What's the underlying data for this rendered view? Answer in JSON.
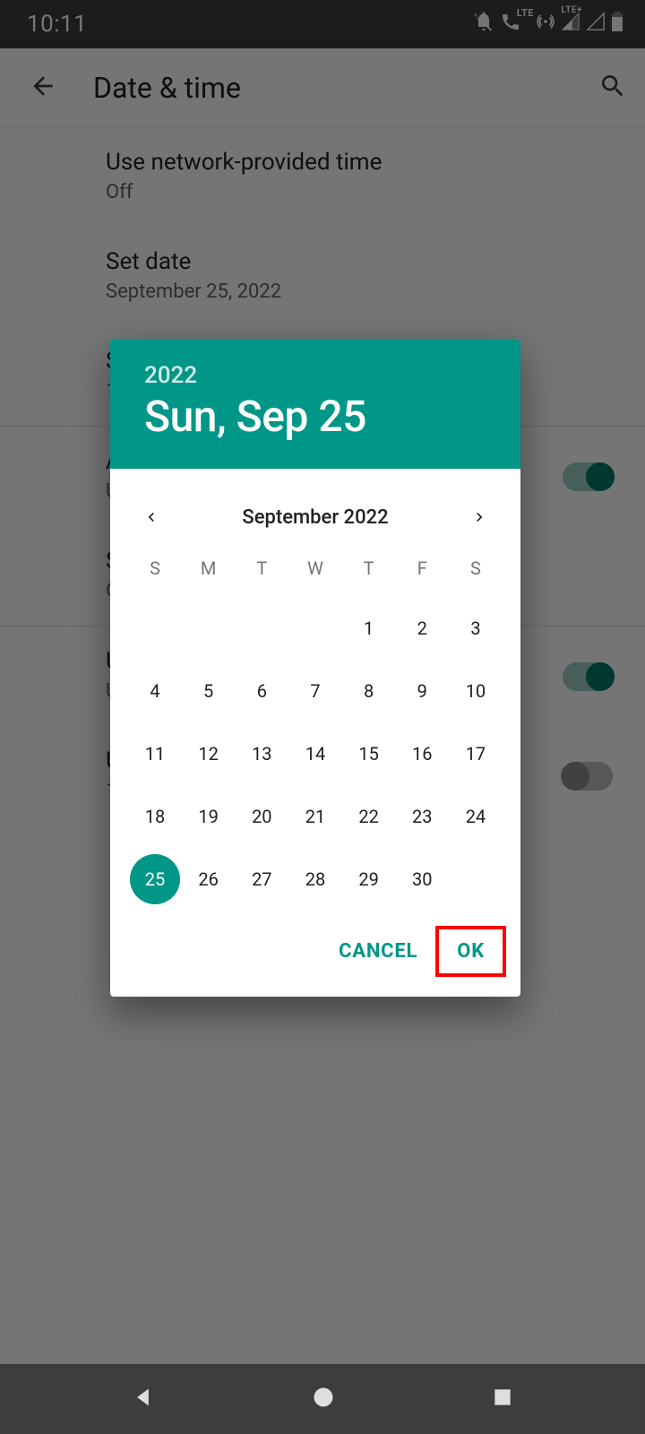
{
  "statusbar": {
    "time": "10:11",
    "lte_label": "LTE",
    "lte_plus_label": "LTE+"
  },
  "appbar": {
    "title": "Date & time"
  },
  "settings": {
    "network_time": {
      "title": "Use network-provided time",
      "value": "Off"
    },
    "set_date": {
      "title": "Set date",
      "value": "September 25, 2022"
    },
    "set_time": {
      "title": "S",
      "value": "1"
    },
    "auto_tz": {
      "title": "A",
      "value": "U"
    },
    "set_tz": {
      "title": "S",
      "value": "G"
    },
    "use_locale": {
      "title": "U",
      "value": "U"
    },
    "use_24h": {
      "title": "U",
      "value": "1"
    }
  },
  "datepicker": {
    "year": "2022",
    "header_date": "Sun, Sep 25",
    "month_label": "September 2022",
    "dow": [
      "S",
      "M",
      "T",
      "W",
      "T",
      "F",
      "S"
    ],
    "leading_blanks": 4,
    "days_in_month": 30,
    "selected_day": 25,
    "cancel": "CANCEL",
    "ok": "OK"
  },
  "colors": {
    "accent": "#009688"
  }
}
